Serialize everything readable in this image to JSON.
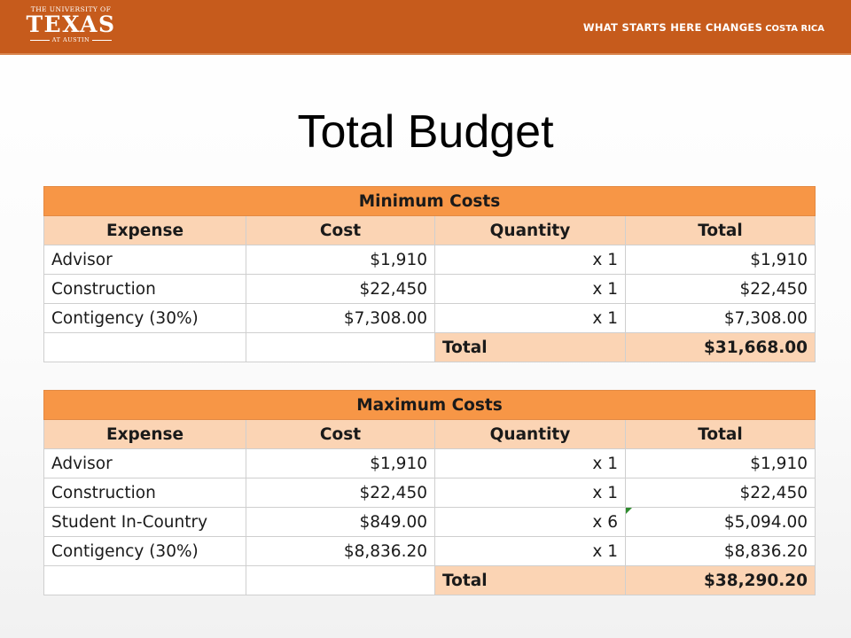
{
  "header": {
    "logo_line1": "THE UNIVERSITY OF",
    "logo_line2": "TEXAS",
    "logo_line3": "AT AUSTIN",
    "tagline": "WHAT STARTS HERE CHANGES",
    "tagline_sub": "COSTA RICA",
    "brand_color": "#c65b1c"
  },
  "title": "Total Budget",
  "colors": {
    "table_title_bg": "#f79646",
    "table_header_bg": "#fbd4b4"
  },
  "tables": [
    {
      "title": "Minimum Costs",
      "headers": [
        "Expense",
        "Cost",
        "Quantity",
        "Total"
      ],
      "rows": [
        [
          "Advisor",
          "$1,910",
          "x 1",
          "$1,910"
        ],
        [
          "Construction",
          "$22,450",
          "x 1",
          "$22,450"
        ],
        [
          "Contigency (30%)",
          "$7,308.00",
          "x 1",
          "$7,308.00"
        ]
      ],
      "total_label": "Total",
      "total_value": "$31,668.00"
    },
    {
      "title": "Maximum Costs",
      "headers": [
        "Expense",
        "Cost",
        "Quantity",
        "Total"
      ],
      "rows": [
        [
          "Advisor",
          "$1,910",
          "x 1",
          "$1,910"
        ],
        [
          "Construction",
          "$22,450",
          "x 1",
          "$22,450"
        ],
        [
          "Student In-Country",
          "$849.00",
          "x 6",
          "$5,094.00"
        ],
        [
          "Contigency (30%)",
          "$8,836.20",
          "x 1",
          "$8,836.20"
        ]
      ],
      "total_label": "Total",
      "total_value": "$38,290.20"
    }
  ]
}
